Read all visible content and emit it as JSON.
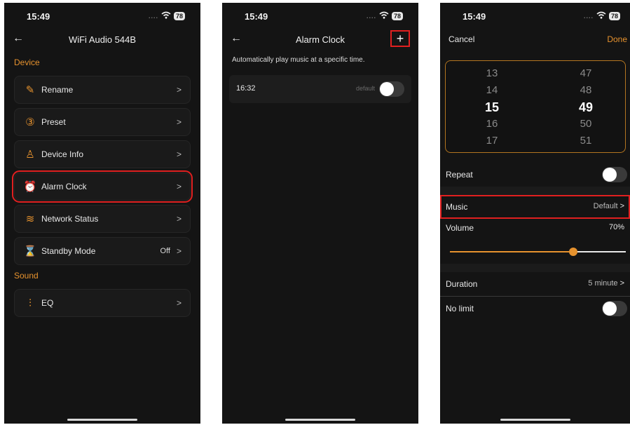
{
  "phone1": {
    "status": {
      "time": "15:49",
      "dots": "....",
      "wifi": "wifi-icon",
      "battery": "78"
    },
    "nav": {
      "back": "←",
      "title": "WiFi Audio 544B"
    },
    "device_section": "Device",
    "items": [
      {
        "label": "Rename",
        "icon": "pencil-icon",
        "glyph": "✎",
        "value": ""
      },
      {
        "label": "Preset",
        "icon": "preset-icon",
        "glyph": "③",
        "value": ""
      },
      {
        "label": "Device Info",
        "icon": "person-icon",
        "glyph": "♙",
        "value": ""
      },
      {
        "label": "Alarm Clock",
        "icon": "alarm-clock-icon",
        "glyph": "⏰",
        "value": ""
      },
      {
        "label": "Network Status",
        "icon": "wifi-icon",
        "glyph": "≋",
        "value": ""
      },
      {
        "label": "Standby Mode",
        "icon": "hourglass-icon",
        "glyph": "⌛",
        "value": "Off"
      }
    ],
    "sound_section": "Sound",
    "eq": {
      "label": "EQ",
      "icon": "equalizer-icon",
      "glyph": "⫶"
    },
    "chevron": ">"
  },
  "phone2": {
    "status": {
      "time": "15:49",
      "dots": "....",
      "battery": "78"
    },
    "nav": {
      "back": "←",
      "title": "Alarm Clock",
      "add": "+"
    },
    "description": "Automatically play music at a specific time.",
    "alarm": {
      "time": "16:32",
      "label": "default",
      "enabled": false
    }
  },
  "phone3": {
    "status": {
      "time": "15:49",
      "dots": "....",
      "battery": "78"
    },
    "nav": {
      "cancel": "Cancel",
      "done": "Done"
    },
    "hours": [
      "13",
      "14",
      "15",
      "16",
      "17"
    ],
    "minutes": [
      "47",
      "48",
      "49",
      "50",
      "51"
    ],
    "repeat": {
      "label": "Repeat",
      "enabled": false
    },
    "music": {
      "label": "Music",
      "value": "Default"
    },
    "volume": {
      "label": "Volume",
      "value": "70%",
      "level": 0.7
    },
    "duration": {
      "label": "Duration",
      "value": "5 minute"
    },
    "no_limit": {
      "label": "No limit",
      "enabled": false
    },
    "chevron": ">"
  },
  "colors": {
    "accent": "#e6922e",
    "highlight": "#e02020",
    "background": "#141414"
  }
}
